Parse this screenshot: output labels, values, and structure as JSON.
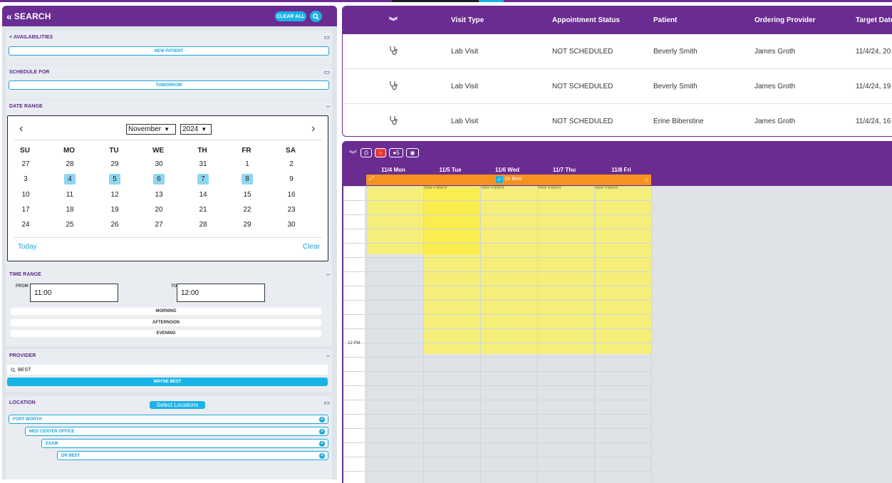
{
  "left": {
    "title": "SEARCH",
    "clear_all": "CLEAR ALL",
    "availabilities": {
      "title": "AVAILABILITIES",
      "value": "NEW PATIENT"
    },
    "schedule_for": {
      "title": "SCHEDULE FOR",
      "value": "TOMORROW"
    },
    "date_range": {
      "title": "DATE RANGE",
      "month": "November",
      "year": "2024",
      "dow": [
        "SU",
        "MO",
        "TU",
        "WE",
        "TH",
        "FR",
        "SA"
      ],
      "weeks": [
        [
          "27",
          "28",
          "29",
          "30",
          "31",
          "1",
          "2"
        ],
        [
          "3",
          "4",
          "5",
          "6",
          "7",
          "8",
          "9"
        ],
        [
          "10",
          "11",
          "12",
          "13",
          "14",
          "15",
          "16"
        ],
        [
          "17",
          "18",
          "19",
          "20",
          "21",
          "22",
          "23"
        ],
        [
          "24",
          "25",
          "26",
          "27",
          "28",
          "29",
          "30"
        ]
      ],
      "highlighted": [
        "4",
        "5",
        "6",
        "7",
        "8"
      ],
      "today": "Today",
      "clear": "Clear"
    },
    "time_range": {
      "title": "TIME RANGE",
      "from_label": "FROM",
      "to_label": "TO",
      "from": "11:00",
      "to": "12:00",
      "options": [
        "MORNING",
        "AFTERNOON",
        "EVENING"
      ]
    },
    "provider": {
      "title": "PROVIDER",
      "search": "BEST",
      "selected": "WAYNE BEST"
    },
    "location": {
      "title": "LOCATION",
      "select_btn": "Select Locations",
      "items": [
        "FORT WORTH",
        "MED CENTER OFFICE",
        "EXAM",
        "DR BEST"
      ]
    }
  },
  "table": {
    "headers": [
      "Visit Type",
      "Appointment Status",
      "Patient",
      "Ordering Provider",
      "Target Date"
    ],
    "rows": [
      {
        "visit_type": "Lab Visit",
        "status": "NOT SCHEDULED",
        "patient": "Beverly Smith",
        "provider": "James Groth",
        "target": "11/4/24, 20"
      },
      {
        "visit_type": "Lab Visit",
        "status": "NOT SCHEDULED",
        "patient": "Beverly Smith",
        "provider": "James Groth",
        "target": "11/4/24, 19"
      },
      {
        "visit_type": "Lab Visit",
        "status": "NOT SCHEDULED",
        "patient": "Erine Biberstine",
        "provider": "James Groth",
        "target": "11/4/24, 16"
      }
    ]
  },
  "scheduler": {
    "badge_count": "5",
    "days": [
      "11/4 Mon",
      "11/5 Tue",
      "11/6 Wed",
      "11/7 Thu",
      "11/8 Fri"
    ],
    "resource": "Dr Best",
    "slot_label": "New Patient",
    "time_label": "12 PM"
  },
  "colors": {
    "purple": "#6a2c91",
    "accent": "#1ab3e6",
    "orange": "#f6931f",
    "yellow": "#f5ef7a"
  }
}
